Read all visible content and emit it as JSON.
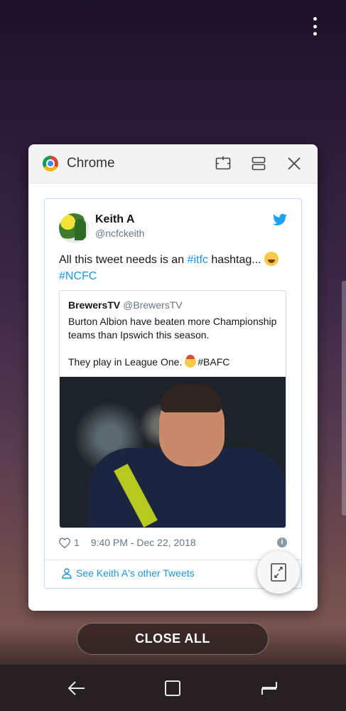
{
  "card": {
    "app_title": "Chrome",
    "header_icons": [
      "split-screen-icon",
      "multi-window-icon",
      "close-icon"
    ]
  },
  "tweet": {
    "author_name": "Keith A",
    "author_handle": "@ncfckeith",
    "text_before": "All this tweet needs is an ",
    "hashtag_1": "#itfc",
    "text_after": " hashtag... ",
    "hashtag_2": "#NCFC",
    "quote": {
      "author": "BrewersTV",
      "handle": "@BrewersTV",
      "line_1": "Burton Albion have beaten more Championship teams than Ipswich this season.",
      "line_2": "They play in League One. ",
      "hashtag": "#BAFC"
    },
    "likes": "1",
    "timestamp": "9:40 PM - Dec 22, 2018",
    "other_tweets_link": "See Keith A's other Tweets"
  },
  "close_all_label": "CLOSE ALL",
  "navbar": {
    "icons": [
      "back-icon",
      "home-icon",
      "recents-icon"
    ]
  }
}
